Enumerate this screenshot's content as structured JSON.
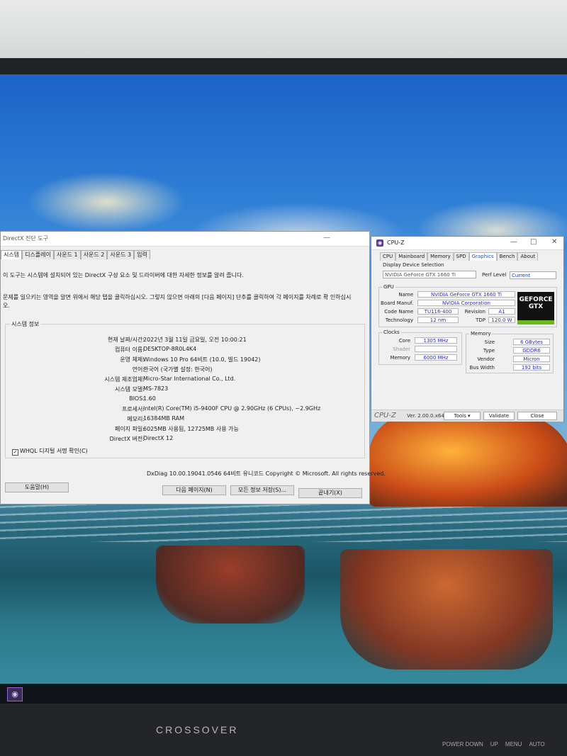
{
  "directx": {
    "title": "DirectX 진단 도구",
    "tabs": [
      "시스템",
      "디스플레이",
      "사운드 1",
      "사운드 2",
      "사운드 3",
      "입력"
    ],
    "intro": "이 도구는 시스템에 설치되어 있는 DirectX 구성 요소 및 드라이버에 대한 자세한 정보를 알려 줍니다.",
    "intro2": "문제를 일으키는 영역을 알면 위에서 해당 탭을 클릭하십시오. 그렇지 않으면 아래의 [다음 페이지] 단추를 클릭하여 각 페이지를 차례로 확 인하십시오.",
    "section_title": "시스템 정보",
    "rows": [
      {
        "label": "현재 날짜/시간:",
        "value": "2022년 3월 11일 금요일, 오전 10:00:21"
      },
      {
        "label": "컴퓨터 이름:",
        "value": "DESKTOP-8R0L4K4"
      },
      {
        "label": "운영 체제:",
        "value": "Windows 10 Pro 64비트 (10.0, 빌드 19042)"
      },
      {
        "label": "언어:",
        "value": "한국어 (국가별 설정: 한국어)"
      },
      {
        "label": "시스템 제조업체:",
        "value": "Micro-Star International Co., Ltd."
      },
      {
        "label": "시스템 모델:",
        "value": "MS-7823"
      },
      {
        "label": "BIOS:",
        "value": "1.60"
      },
      {
        "label": "프로세서:",
        "value": "Intel(R) Core(TM) i5-9400F CPU @ 2.90GHz (6 CPUs), ~2.9GHz"
      },
      {
        "label": "메모리:",
        "value": "16384MB RAM"
      },
      {
        "label": "페이지 파일:",
        "value": "6025MB 사용됨, 12725MB 사용 가능"
      },
      {
        "label": "DirectX 버전:",
        "value": "DirectX 12"
      }
    ],
    "whql": "WHQL 디지털 서명 확인(C)",
    "copyright": "DxDiag 10.00.19041.0546 64비트 유니코드 Copyright © Microsoft. All rights reserved.",
    "buttons": {
      "help": "도움말(H)",
      "next": "다음 페이지(N)",
      "save": "모든 정보 저장(S)...",
      "exit": "끝내기(X)"
    }
  },
  "cpuz": {
    "title": "CPU-Z",
    "tabs": [
      "CPU",
      "Mainboard",
      "Memory",
      "SPD",
      "Graphics",
      "Bench",
      "About"
    ],
    "active_tab": "Graphics",
    "display_selection_label": "Display Device Selection",
    "display_device": "NVIDIA GeForce GTX 1660 Ti",
    "perf_level_label": "Perf Level",
    "perf_level": "Current",
    "gpu_group": "GPU",
    "gpu": {
      "name_label": "Name",
      "name": "NVIDIA GeForce GTX 1660 Ti",
      "board_label": "Board Manuf.",
      "board": "NVIDIA Corporation",
      "code_label": "Code Name",
      "code": "TU116-400",
      "rev_label": "Revision",
      "rev": "A1",
      "tech_label": "Technology",
      "tech": "12 nm",
      "tdp_label": "TDP",
      "tdp": "120.0 W"
    },
    "clocks_group": "Clocks",
    "clocks": {
      "core_label": "Core",
      "core": "1305 MHz",
      "shader_label": "Shader",
      "shader": "",
      "memory_label": "Memory",
      "memory": "6000 MHz"
    },
    "memory_group": "Memory",
    "memory": {
      "size_label": "Size",
      "size": "6 GBytes",
      "type_label": "Type",
      "type": "GDDR6",
      "vendor_label": "Vendor",
      "vendor": "Micron",
      "bus_label": "Bus Width",
      "bus": "192 bits"
    },
    "badge": {
      "line1": "GEFORCE",
      "line2": "GTX"
    },
    "footer": {
      "brand": "CPU-Z",
      "version": "Ver. 2.00.0.x64",
      "tools": "Tools",
      "validate": "Validate",
      "close": "Close"
    }
  },
  "monitor": {
    "brand": "CROSSOVER",
    "buttons": [
      "POWER DOWN",
      "UP",
      "MENU",
      "AUTO"
    ]
  }
}
